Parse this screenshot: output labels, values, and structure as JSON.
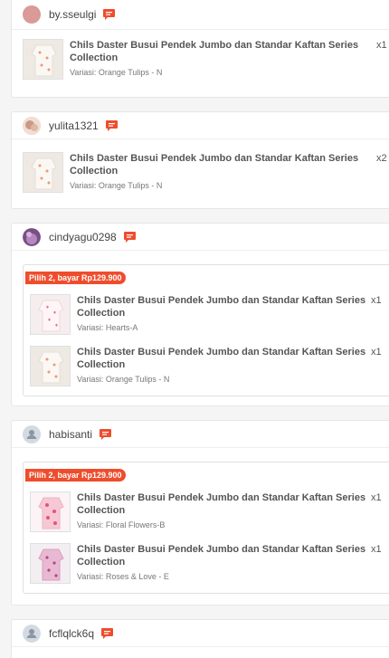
{
  "reviews": [
    {
      "username": "by.sseulgi",
      "items": [
        {
          "title": "Chils Daster Busui Pendek Jumbo dan Standar Kaftan Series Collection",
          "variation": "Variasi: Orange Tulips - N",
          "qty": "x1"
        }
      ]
    },
    {
      "username": "yulita1321",
      "items": [
        {
          "title": "Chils Daster Busui Pendek Jumbo dan Standar Kaftan Series Collection",
          "variation": "Variasi: Orange Tulips - N",
          "qty": "x2"
        }
      ]
    },
    {
      "username": "cindyagu0298",
      "bundle_label": "Pilih 2, bayar Rp129.900",
      "items": [
        {
          "title": "Chils Daster Busui Pendek Jumbo dan Standar Kaftan Series Collection",
          "variation": "Variasi: Hearts-A",
          "qty": "x1"
        },
        {
          "title": "Chils Daster Busui Pendek Jumbo dan Standar Kaftan Series Collection",
          "variation": "Variasi: Orange Tulips - N",
          "qty": "x1"
        }
      ]
    },
    {
      "username": "habisanti",
      "bundle_label": "Pilih 2, bayar Rp129.900",
      "items": [
        {
          "title": "Chils Daster Busui Pendek Jumbo dan Standar Kaftan Series Collection",
          "variation": "Variasi: Floral Flowers-B",
          "qty": "x1"
        },
        {
          "title": "Chils Daster Busui Pendek Jumbo dan Standar Kaftan Series Collection",
          "variation": "Variasi: Roses & Love - E",
          "qty": "x1"
        }
      ]
    },
    {
      "username": "fcflqlck6q",
      "items": []
    }
  ],
  "colors": {
    "accent": "#ee4d2d",
    "badge": "#ee4d2d"
  }
}
